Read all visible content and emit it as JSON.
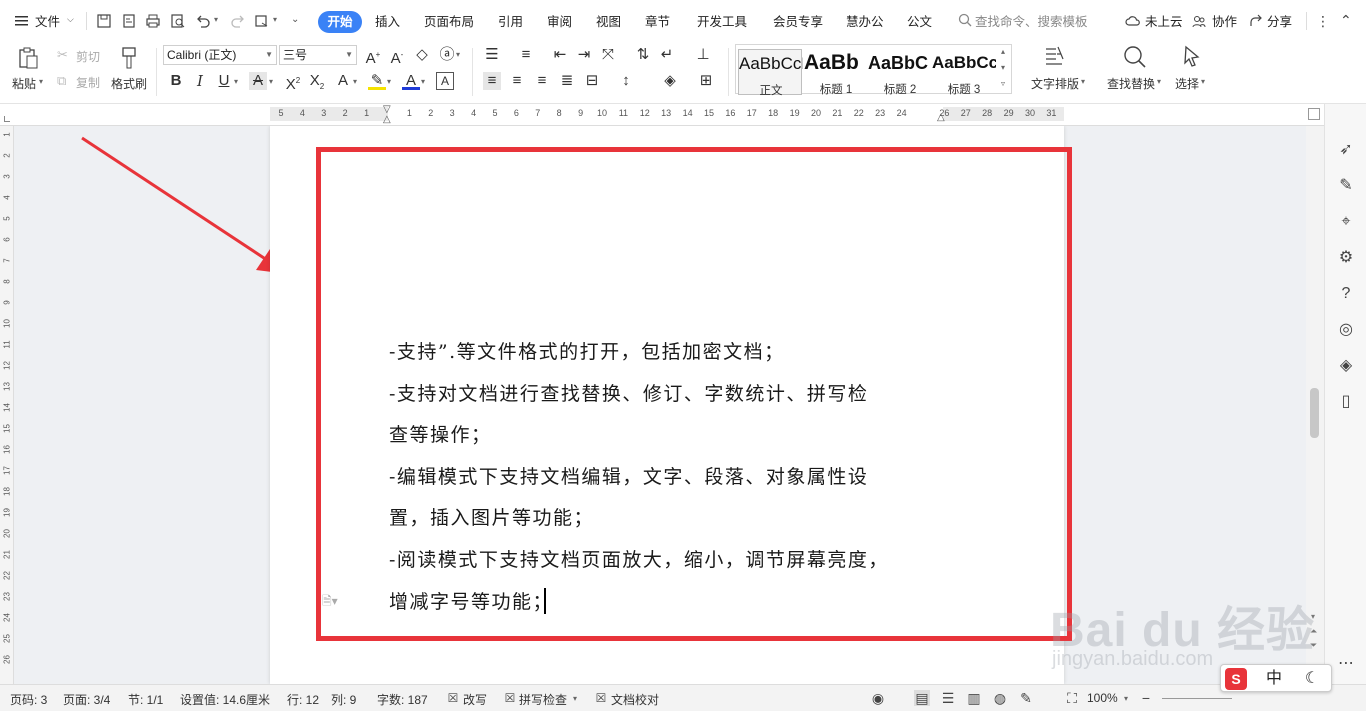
{
  "menubar": {
    "file_label": "文件",
    "tabs": [
      "开始",
      "插入",
      "页面布局",
      "引用",
      "审阅",
      "视图",
      "章节",
      "开发工具",
      "会员专享",
      "慧办公",
      "公文"
    ],
    "search_placeholder": "查找命令、搜索模板",
    "cloud_label": "未上云",
    "collab_label": "协作",
    "share_label": "分享"
  },
  "ribbon": {
    "paste_label": "粘贴",
    "cut_label": "剪切",
    "copy_label": "复制",
    "format_painter_label": "格式刷",
    "font_name": "Calibri (正文)",
    "font_size": "三号",
    "styles": [
      {
        "sample": "AaBbCcDd",
        "name": "正文"
      },
      {
        "sample": "AaBb",
        "name": "标题 1"
      },
      {
        "sample": "AaBbC",
        "name": "标题 2"
      },
      {
        "sample": "AaBbCc",
        "name": "标题 3"
      }
    ],
    "text_layout_label": "文字排版",
    "find_replace_label": "查找替换",
    "select_label": "选择"
  },
  "ruler": {
    "numbers": [
      "5",
      "4",
      "3",
      "2",
      "1",
      "",
      "1",
      "2",
      "3",
      "4",
      "5",
      "6",
      "7",
      "8",
      "9",
      "10",
      "11",
      "12",
      "13",
      "14",
      "15",
      "16",
      "17",
      "18",
      "19",
      "20",
      "21",
      "22",
      "23",
      "24",
      "",
      "26",
      "27",
      "28",
      "29",
      "30",
      "31"
    ]
  },
  "vruler": {
    "numbers": [
      "1",
      "2",
      "3",
      "4",
      "5",
      "6",
      "7",
      "8",
      "9",
      "10",
      "11",
      "12",
      "13",
      "14",
      "15",
      "16",
      "17",
      "18",
      "19",
      "20",
      "21",
      "22",
      "23",
      "24",
      "25",
      "26"
    ]
  },
  "document": {
    "lines": [
      "-支持”.等文件格式的打开，包括加密文档；",
      "-支持对文档进行查找替换、修订、字数统计、拼写检",
      "查等操作；",
      "-编辑模式下支持文档编辑，文字、段落、对象属性设",
      "置，插入图片等功能；",
      "-阅读模式下支持文档页面放大，缩小，调节屏幕亮度，",
      "增减字号等功能；"
    ]
  },
  "statusbar": {
    "page_num": "页码: 3",
    "pages": "页面: 3/4",
    "section": "节: 1/1",
    "setting_value": "设置值: 14.6厘米",
    "row": "行: 12",
    "col": "列: 9",
    "word_count": "字数: 187",
    "revise_label": "改写",
    "spellcheck_label": "拼写检查",
    "doc_proof_label": "文档校对",
    "zoom": "100%"
  },
  "watermark": {
    "logo_text": "Bai du 经验",
    "url": "jingyan.baidu.com"
  },
  "ime": {
    "mode": "中"
  },
  "colors": {
    "accent": "#3a82f6",
    "highlight_box": "#e8343a"
  }
}
